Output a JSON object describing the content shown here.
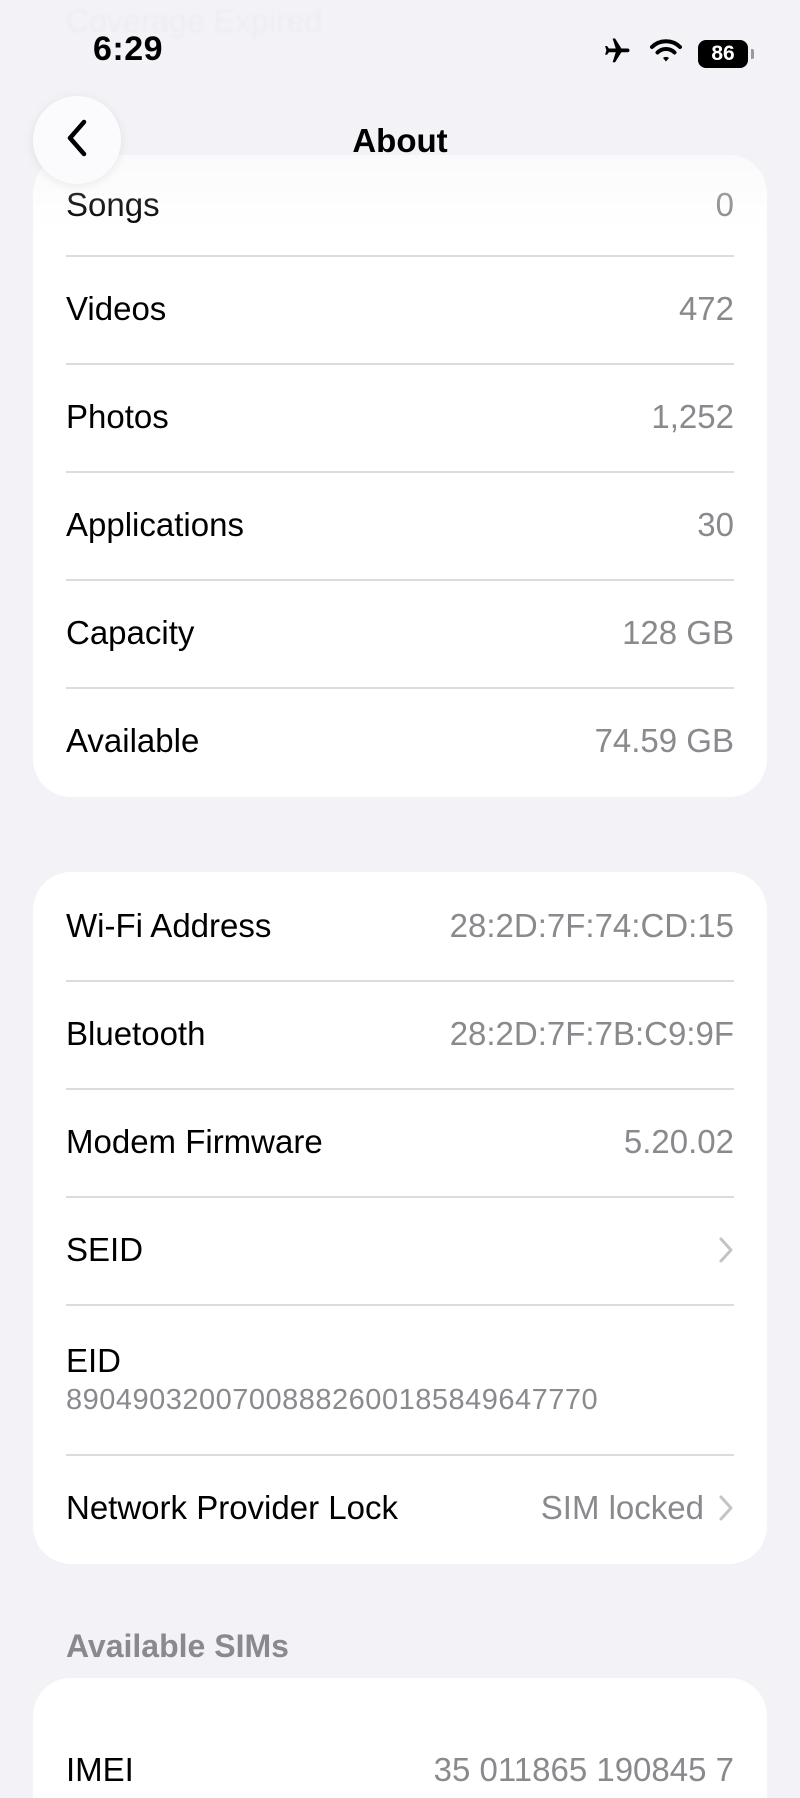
{
  "status_bar": {
    "time": "6:29",
    "battery": "86"
  },
  "ghost_row": {
    "label": "Coverage Expired"
  },
  "nav": {
    "title": "About"
  },
  "media_group": [
    {
      "label": "Songs",
      "value": "0"
    },
    {
      "label": "Videos",
      "value": "472"
    },
    {
      "label": "Photos",
      "value": "1,252"
    },
    {
      "label": "Applications",
      "value": "30"
    },
    {
      "label": "Capacity",
      "value": "128 GB"
    },
    {
      "label": "Available",
      "value": "74.59 GB"
    }
  ],
  "network_group": {
    "wifi": {
      "label": "Wi-Fi Address",
      "value": "28:2D:7F:74:CD:15"
    },
    "bluetooth": {
      "label": "Bluetooth",
      "value": "28:2D:7F:7B:C9:9F"
    },
    "modem": {
      "label": "Modem Firmware",
      "value": "5.20.02"
    },
    "seid": {
      "label": "SEID"
    },
    "eid": {
      "label": "EID",
      "value": "89049032007008882600185849647770"
    },
    "lock": {
      "label": "Network Provider Lock",
      "value": "SIM locked"
    }
  },
  "sims_section": {
    "header": "Available SIMs",
    "imei": {
      "label": "IMEI",
      "value": "35 011865 190845 7"
    }
  },
  "colors": {
    "background": "#f2f2f7",
    "card": "#ffffff",
    "secondary_text": "#8a8a8e",
    "separator": "#dcdce0"
  }
}
